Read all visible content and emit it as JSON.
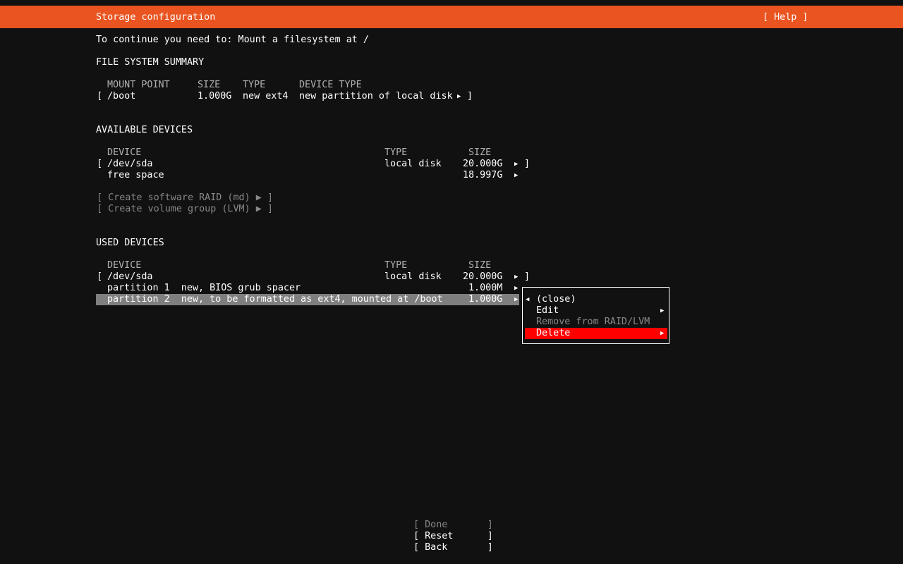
{
  "header": {
    "title": "Storage configuration",
    "help": "[ Help ]"
  },
  "instruction": "To continue you need to: Mount a filesystem at /",
  "fs_summary": {
    "heading": "FILE SYSTEM SUMMARY",
    "columns": [
      "MOUNT POINT",
      "SIZE",
      "TYPE",
      "DEVICE TYPE"
    ],
    "rows": [
      {
        "bracket_open": "[",
        "mount": "/boot",
        "size": "1.000G",
        "type": "new ext4",
        "device_type": "new partition of local disk",
        "arrow": "▶",
        "bracket_close": "]"
      }
    ]
  },
  "available": {
    "heading": "AVAILABLE DEVICES",
    "columns": [
      "DEVICE",
      "TYPE",
      "SIZE"
    ],
    "device": {
      "bracket_open": "[",
      "name": "/dev/sda",
      "type": "local disk",
      "size": "20.000G",
      "arrow": "▶",
      "bracket_close": "]"
    },
    "free": {
      "name": "free space",
      "size": "18.997G",
      "arrow": "▶"
    },
    "actions": [
      "[ Create software RAID (md) ▶ ]",
      "[ Create volume group (LVM) ▶ ]"
    ]
  },
  "used": {
    "heading": "USED DEVICES",
    "columns": [
      "DEVICE",
      "TYPE",
      "SIZE"
    ],
    "device": {
      "bracket_open": "[",
      "name": "/dev/sda",
      "type": "local disk",
      "size": "20.000G",
      "arrow": "▶",
      "bracket_close": "]"
    },
    "partitions": [
      {
        "name": "partition 1  new, BIOS grub spacer",
        "size": "1.000M",
        "arrow": "▶"
      },
      {
        "name": "partition 2  new, to be formatted as ext4, mounted at /boot",
        "size": "1.000G",
        "arrow": "▶"
      }
    ]
  },
  "popup": {
    "close": "(close)",
    "close_arrow": "◀",
    "items": [
      {
        "label": "Edit",
        "arrow": "▶"
      },
      {
        "label": "Remove from RAID/LVM",
        "arrow": ""
      },
      {
        "label": "Delete",
        "arrow": "▶"
      }
    ]
  },
  "buttons": {
    "done": "[ Done       ]",
    "reset": "[ Reset      ]",
    "back": "[ Back       ]"
  },
  "colors": {
    "header": "#e95420",
    "selected_row": "#7f7f7f",
    "popup_selected": "#ff0000"
  }
}
